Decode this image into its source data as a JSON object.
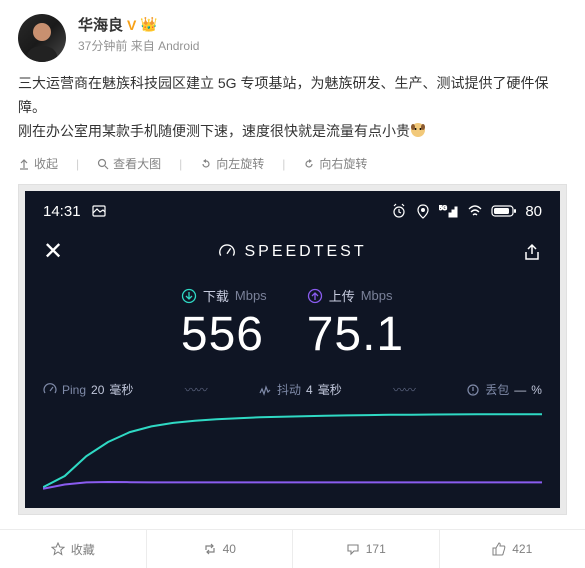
{
  "user": {
    "name": "华海良",
    "verified_label": "V",
    "crown_emoji": "👑"
  },
  "meta": {
    "time": "37分钟前",
    "source_prefix": "来自",
    "source": "Android"
  },
  "content": {
    "p1": "三大运营商在魅族科技园区建立 5G 专项基站，为魅族研发、生产、测试提供了硬件保障。",
    "p2": "刚在办公室用某款手机随便测下速，速度很快就是流量有点小贵"
  },
  "image_tools": {
    "collapse": "收起",
    "view_large": "查看大图",
    "rotate_left": "向左旋转",
    "rotate_right": "向右旋转"
  },
  "speedtest": {
    "status_time": "14:31",
    "battery": "80",
    "brand": "SPEEDTEST",
    "download": {
      "label": "下载",
      "unit": "Mbps",
      "value": "556"
    },
    "upload": {
      "label": "上传",
      "unit": "Mbps",
      "value": "75.1"
    },
    "ping": {
      "label": "Ping",
      "value": "20",
      "unit": "毫秒"
    },
    "jitter": {
      "label": "抖动",
      "value": "4",
      "unit": "毫秒"
    },
    "loss": {
      "label": "丢包",
      "value": "—",
      "unit": "%"
    }
  },
  "actions": {
    "favorite": "收藏",
    "repost_count": "40",
    "comment_count": "171",
    "like_count": "421"
  },
  "chart_data": {
    "type": "line",
    "xlabel": "",
    "ylabel": "",
    "series": [
      {
        "name": "download",
        "color": "#2fd9c4",
        "values": [
          40,
          120,
          260,
          360,
          430,
          470,
          495,
          510,
          520,
          528,
          534,
          538,
          542,
          545,
          548,
          550,
          552,
          553,
          554,
          555,
          556,
          556,
          556,
          556
        ]
      },
      {
        "name": "upload",
        "color": "#8a5cf0",
        "values": [
          30,
          60,
          75,
          78,
          76,
          75,
          75,
          75,
          75,
          75,
          75,
          75,
          75,
          75,
          75,
          75,
          75,
          75,
          75,
          75,
          75,
          75,
          75,
          75
        ]
      }
    ],
    "ylim": [
      0,
      600
    ]
  }
}
